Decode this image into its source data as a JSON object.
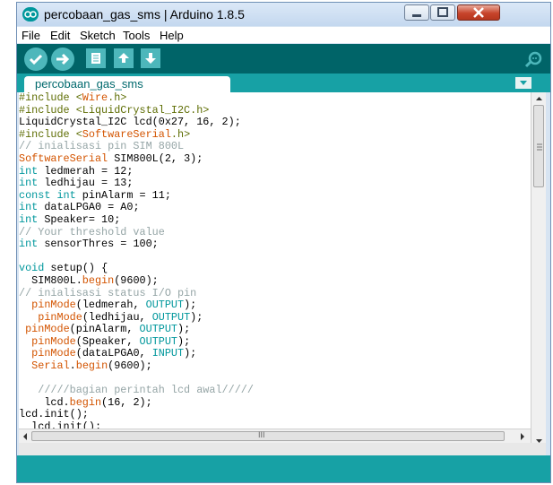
{
  "window": {
    "title": "percobaan_gas_sms | Arduino 1.8.5",
    "accent_color": "#17a1a5",
    "toolbar_color": "#006468"
  },
  "menu": [
    "File",
    "Edit",
    "Sketch",
    "Tools",
    "Help"
  ],
  "toolbar": {
    "buttons": [
      "verify-icon",
      "upload-icon",
      "new-icon",
      "open-icon",
      "save-icon"
    ],
    "right_button": "serial-monitor-icon"
  },
  "tab": {
    "label": "percobaan_gas_sms"
  },
  "syntax_colors": {
    "directive": "#5e6d03",
    "keyword": "#d35400",
    "type": "#00979c",
    "comment": "#95a5a6",
    "default": "#000000"
  },
  "code": [
    [
      [
        "#include <",
        "directive"
      ],
      [
        "Wire",
        "keyword"
      ],
      [
        ".h>",
        "directive"
      ]
    ],
    [
      [
        "#include <LiquidCrystal_I2C.h>",
        "directive"
      ]
    ],
    [
      [
        "LiquidCrystal_I2C lcd(0x27, 16, 2);",
        "default"
      ]
    ],
    [
      [
        "#include <",
        "directive"
      ],
      [
        "SoftwareSerial",
        "keyword"
      ],
      [
        ".h>",
        "directive"
      ]
    ],
    [
      [
        "// inialisasi pin SIM 800L",
        "comment"
      ]
    ],
    [
      [
        "SoftwareSerial",
        "keyword"
      ],
      [
        " SIM800L(2, 3);",
        "default"
      ]
    ],
    [
      [
        "int",
        "type"
      ],
      [
        " ledmerah = 12;",
        "default"
      ]
    ],
    [
      [
        "int",
        "type"
      ],
      [
        " ledhijau = 13;",
        "default"
      ]
    ],
    [
      [
        "const int",
        "type"
      ],
      [
        " pinAlarm = 11;",
        "default"
      ]
    ],
    [
      [
        "int",
        "type"
      ],
      [
        " dataLPGA0 = A0;",
        "default"
      ]
    ],
    [
      [
        "int",
        "type"
      ],
      [
        " Speaker= 10;",
        "default"
      ]
    ],
    [
      [
        "// Your threshold value",
        "comment"
      ]
    ],
    [
      [
        "int",
        "type"
      ],
      [
        " sensorThres = 100;",
        "default"
      ]
    ],
    [],
    [
      [
        "void",
        "type"
      ],
      [
        " ",
        "default"
      ],
      [
        "setup",
        "default"
      ],
      [
        "() {",
        "default"
      ]
    ],
    [
      [
        "  SIM800L.",
        "default"
      ],
      [
        "begin",
        "keyword"
      ],
      [
        "(9600);",
        "default"
      ]
    ],
    [
      [
        "// inialisasi status I/O pin",
        "comment"
      ]
    ],
    [
      [
        "  ",
        "default"
      ],
      [
        "pinMode",
        "keyword"
      ],
      [
        "(ledmerah, ",
        "default"
      ],
      [
        "OUTPUT",
        "type"
      ],
      [
        ");",
        "default"
      ]
    ],
    [
      [
        "   ",
        "default"
      ],
      [
        "pinMode",
        "keyword"
      ],
      [
        "(ledhijau, ",
        "default"
      ],
      [
        "OUTPUT",
        "type"
      ],
      [
        ");",
        "default"
      ]
    ],
    [
      [
        " ",
        "default"
      ],
      [
        "pinMode",
        "keyword"
      ],
      [
        "(pinAlarm, ",
        "default"
      ],
      [
        "OUTPUT",
        "type"
      ],
      [
        ");",
        "default"
      ]
    ],
    [
      [
        "  ",
        "default"
      ],
      [
        "pinMode",
        "keyword"
      ],
      [
        "(Speaker, ",
        "default"
      ],
      [
        "OUTPUT",
        "type"
      ],
      [
        ");",
        "default"
      ]
    ],
    [
      [
        "  ",
        "default"
      ],
      [
        "pinMode",
        "keyword"
      ],
      [
        "(dataLPGA0, ",
        "default"
      ],
      [
        "INPUT",
        "type"
      ],
      [
        ");",
        "default"
      ]
    ],
    [
      [
        "  ",
        "default"
      ],
      [
        "Serial",
        "keyword"
      ],
      [
        ".",
        "default"
      ],
      [
        "begin",
        "keyword"
      ],
      [
        "(9600);",
        "default"
      ]
    ],
    [],
    [
      [
        "   /////bagian perintah lcd awal/////",
        "comment"
      ]
    ],
    [
      [
        "    lcd.",
        "default"
      ],
      [
        "begin",
        "keyword"
      ],
      [
        "(16, 2);",
        "default"
      ]
    ],
    [
      [
        "lcd.init();",
        "default"
      ]
    ],
    [
      [
        "  lcd.init();",
        "default"
      ]
    ]
  ],
  "scrollbar": {
    "vertical_position": 0.0,
    "horizontal_thumb_label": "III"
  }
}
